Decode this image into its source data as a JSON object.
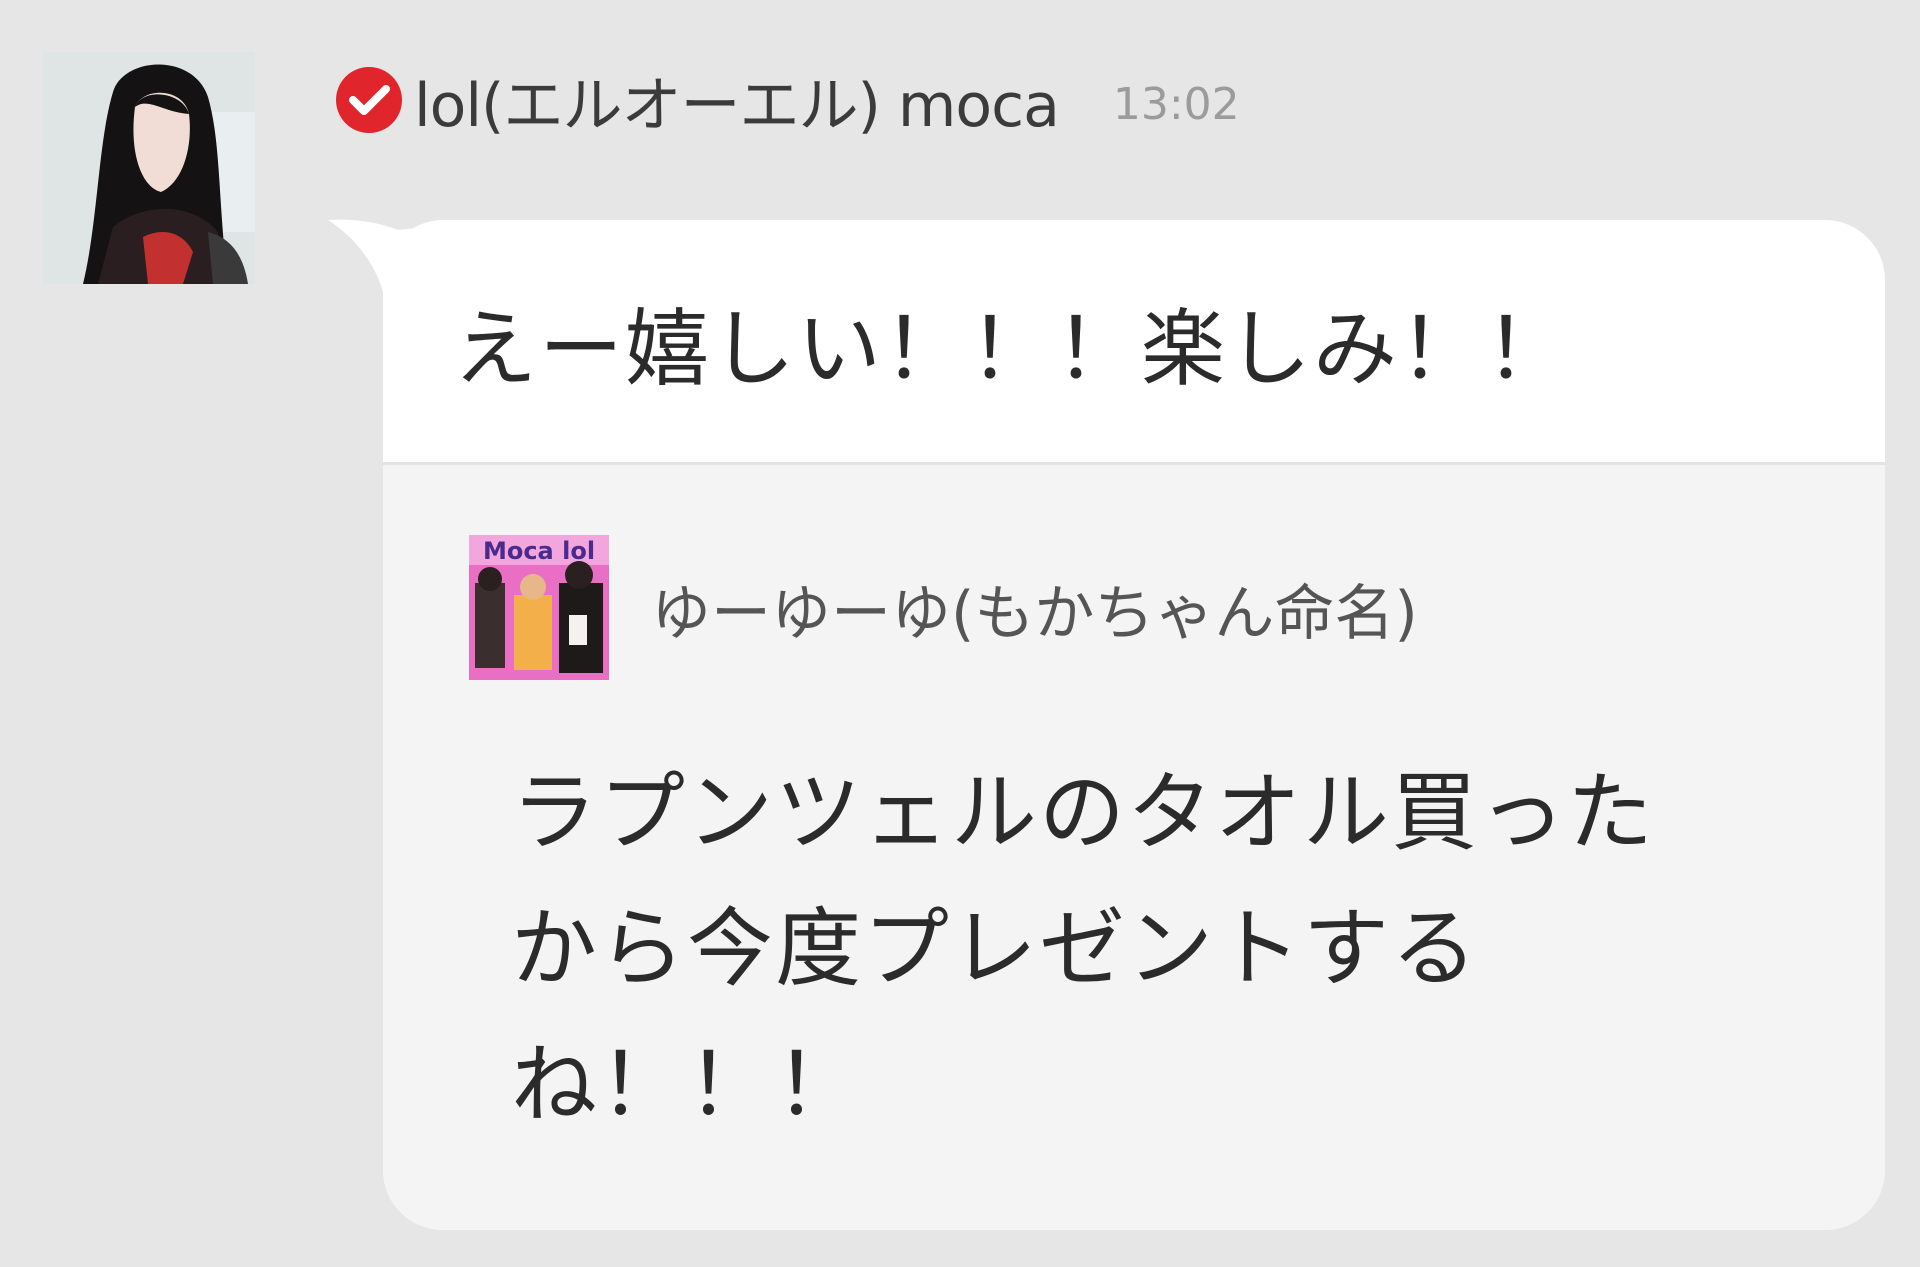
{
  "message": {
    "sender": "lol(エルオーエル) moca",
    "time": "13:02",
    "text": "えー嬉しい！！！楽しみ！！",
    "verified_icon": "checkmark-badge-icon",
    "colors": {
      "verified_badge": "#e0262c",
      "bubble": "#ffffff",
      "quote_background": "#f4f4f4",
      "page_background": "#e6e6e6"
    },
    "quote": {
      "author": "ゆーゆーゆ(もかちゃん命名)",
      "text": "ラプンツェルのタオル買ったから今度プレゼントするね！！！",
      "avatar_text": "Moca lol"
    }
  }
}
